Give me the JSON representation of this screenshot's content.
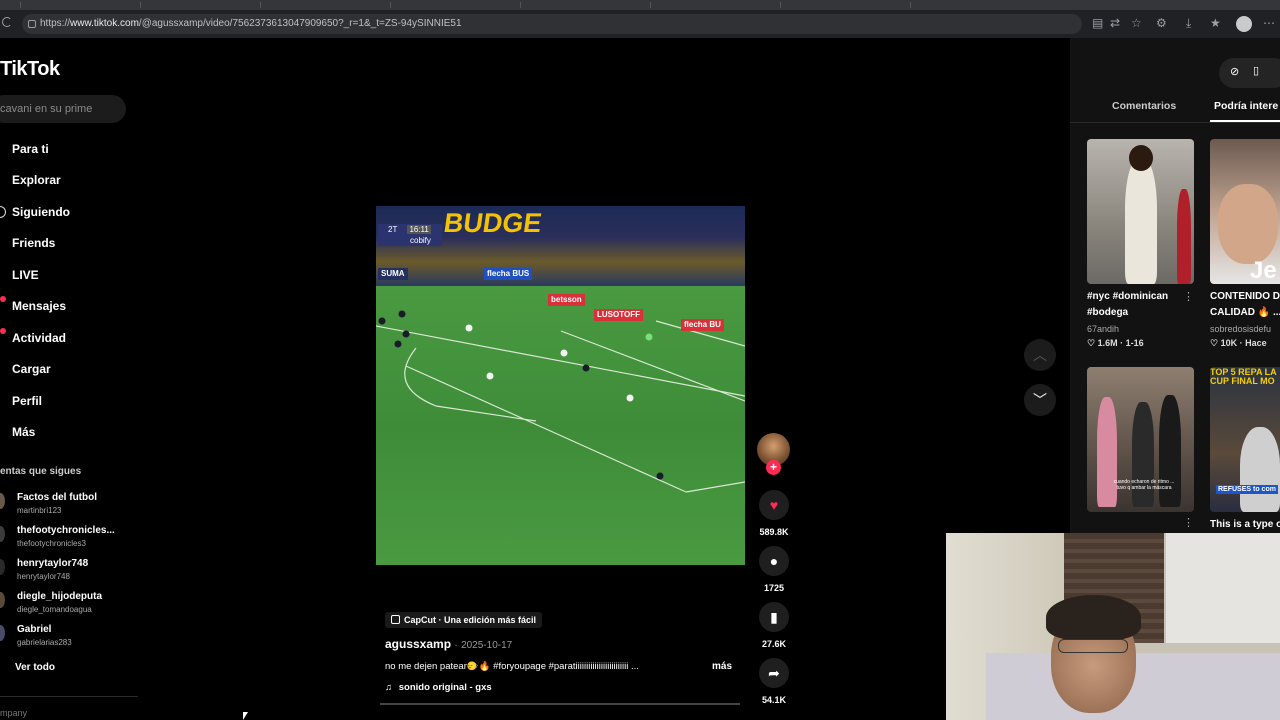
{
  "browser": {
    "url_prefix": "https://",
    "url_domain": "www.tiktok.com",
    "url_path": "/@agussxamp/video/7562373613047909650?_r=1&_t=ZS-94ySINNIE51"
  },
  "sidebar": {
    "logo": "TikTok",
    "search_placeholder": "cavani en su prime",
    "nav": [
      {
        "label": "Para ti",
        "icon": "home-icon"
      },
      {
        "label": "Explorar",
        "icon": "compass-icon"
      },
      {
        "label": "Siguiendo",
        "icon": "following-icon"
      },
      {
        "label": "Friends",
        "icon": "friends-icon"
      },
      {
        "label": "LIVE",
        "icon": "live-icon"
      },
      {
        "label": "Mensajes",
        "icon": "messages-icon"
      },
      {
        "label": "Actividad",
        "icon": "activity-icon"
      },
      {
        "label": "Cargar",
        "icon": "upload-icon"
      },
      {
        "label": "Perfil",
        "icon": "profile-icon"
      },
      {
        "label": "Más",
        "icon": "more-icon"
      }
    ],
    "following_title": "entas que sigues",
    "accounts": [
      {
        "name": "Factos del futbol",
        "handle": "martinbri123"
      },
      {
        "name": "thefootychronicles...",
        "handle": "thefootychronicles3"
      },
      {
        "name": "henrytaylor748",
        "handle": "henrytaylor748"
      },
      {
        "name": "diegle_hijodeputa",
        "handle": "diegle_tomandoagua"
      },
      {
        "name": "Gabriel",
        "handle": "gabrielarias283"
      }
    ],
    "see_all": "Ver todo",
    "footer": "mpany"
  },
  "video": {
    "banner_text": "BUDGE",
    "scorebug_half": "2T",
    "scorebug_time": "16:11",
    "scorebug_sponsor": "cobify",
    "ads": [
      "flecha BUS",
      "betsson",
      "LUSOTOFF",
      "flecha BU",
      "SUMA"
    ],
    "capcut_label": "CapCut · Una edición más fácil",
    "author": "agussxamp",
    "date": "2025-10-17",
    "description": "no me dejen patear🙂‍↔️🔥 #foryoupage #paratiiiiiiiiiiiiiiiiiiiiiiiii ...",
    "more": "más",
    "music": "sonido original - gxs"
  },
  "actions": {
    "likes": "589.8K",
    "comments": "1725",
    "saves": "27.6K",
    "shares": "54.1K"
  },
  "right_panel": {
    "tab_comments": "Comentarios",
    "tab_related": "Podría intere",
    "videos": [
      {
        "title_line1": "#nyc #dominican",
        "title_line2": "#bodega",
        "author": "67andih",
        "views": "1.6M",
        "date": "1-16"
      },
      {
        "title_line1": "CONTENIDO D",
        "title_line2": "CALIDAD 🔥 ...",
        "author": "sobredosisdefu",
        "views": "10K",
        "date": "Hace"
      },
      {
        "overlay": "cuando echaron de ritmo ... tuvo q ambar la máscara"
      },
      {
        "title_line1": "This is a type o",
        "overlay_top": "TOP 5 REPA LA",
        "overlay_top2": "CUP FINAL MO",
        "overlay_bottom": "REFUSES to com"
      }
    ]
  },
  "colors": {
    "accent": "#fe2c55",
    "background": "#000000",
    "panel": "#121212"
  }
}
